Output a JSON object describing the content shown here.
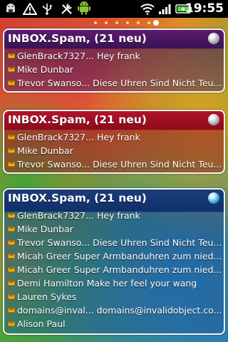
{
  "status_bar": {
    "clock": "19:55",
    "icons": [
      "android-usb-icon",
      "warning-icon",
      "usb-icon",
      "tools-icon",
      "android-icon",
      "wifi-icon",
      "signal-icon",
      "battery-icon"
    ]
  },
  "pager": {
    "count": 7,
    "active_index": 6
  },
  "widgets": [
    {
      "title": "INBOX.Spam, (21 neu)",
      "color": "#4a1660",
      "items": [
        "GlenBrack7327... Hey frank",
        "Mike Dunbar",
        "Trevor Swanso... Diese Uhren Sind Nicht Teu..."
      ]
    },
    {
      "title": "INBOX.Spam, (21 neu)",
      "color": "#a11024",
      "items": [
        "GlenBrack7327... Hey frank",
        "Mike Dunbar",
        "Trevor Swanso... Diese Uhren Sind Nicht Teu..."
      ]
    },
    {
      "title": "INBOX.Spam, (21 neu)",
      "color": "#163a78",
      "items": [
        "GlenBrack7327... Hey frank",
        "Mike Dunbar",
        "Trevor Swanso... Diese Uhren Sind Nicht Teu...",
        "Micah Greer Super Armbanduhren zum nied...",
        "Micah Greer Super Armbanduhren zum nied...",
        "Demi Hamilton Make her feel your wang",
        "Lauren Sykes",
        "domains@inval... domains@invalidobject.co...",
        "Alison Paul"
      ]
    }
  ]
}
